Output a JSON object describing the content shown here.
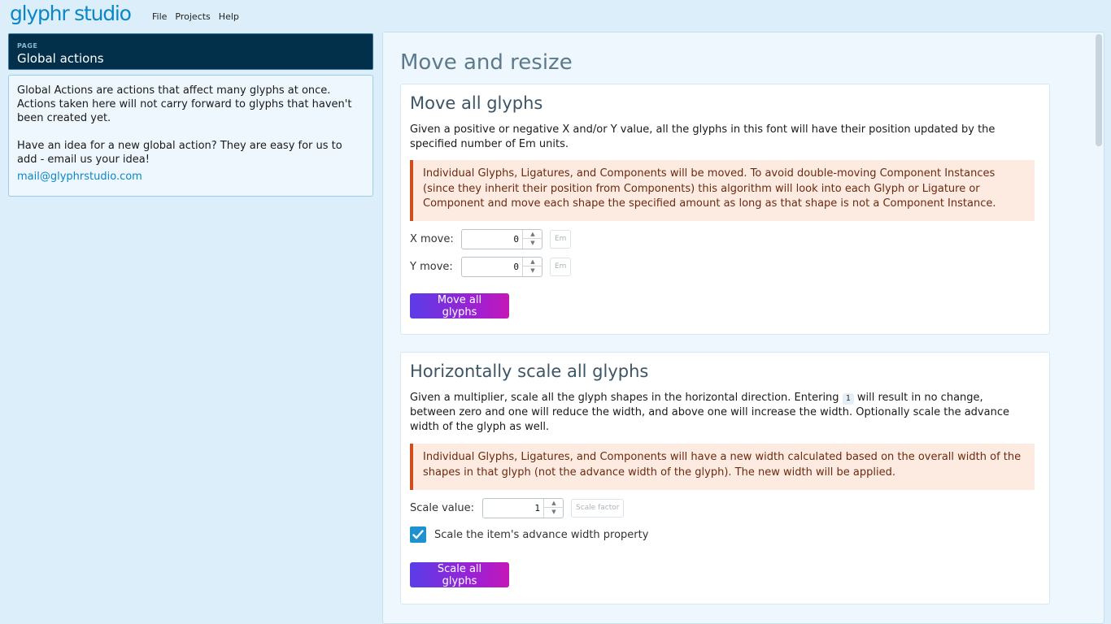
{
  "app": {
    "logo": "glyphr studio",
    "menu": [
      "File",
      "Projects",
      "Help"
    ]
  },
  "sidebar": {
    "kicker": "PAGE",
    "title": "Global actions",
    "paragraph1": "Global Actions are actions that affect many glyphs at once. Actions taken here will not carry forward to glyphs that haven't been created yet.",
    "paragraph2": "Have an idea for a new global action? They are easy for us to add - email us your idea!",
    "email": "mail@glyphrstudio.com"
  },
  "main": {
    "title": "Move and resize",
    "move_card": {
      "title": "Move all glyphs",
      "description": "Given a positive or negative X and/or Y value, all the glyphs in this font will have their position updated by the specified number of Em units.",
      "notice": "Individual Glyphs, Ligatures, and Components will be moved. To avoid double-moving Component Instances (since they inherit their position from Components) this algorithm will look into each Glyph or Ligature or Component and move each shape the specified amount as long as that shape is not a Component Instance.",
      "x_label": "X move:",
      "x_value": "0",
      "y_label": "Y move:",
      "y_value": "0",
      "unit": "Em",
      "button": "Move all glyphs"
    },
    "scale_card": {
      "title": "Horizontally scale all glyphs",
      "description_before": "Given a multiplier, scale all the glyph shapes in the horizontal direction. Entering",
      "description_code": "1",
      "description_after": "will result in no change, between zero and one will reduce the width, and above one will increase the width. Optionally scale the advance width of the glyph as well.",
      "notice": "Individual Glyphs, Ligatures, and Components will have a new width calculated based on the overall width of the shapes in that glyph (not the advance width of the glyph). The new width will be applied.",
      "scale_label": "Scale value:",
      "scale_value": "1",
      "unit": "Scale factor",
      "checkbox_label": "Scale the item's advance width property",
      "checkbox_checked": true,
      "button": "Scale all glyphs"
    }
  },
  "colors": {
    "background": "#dbeefa",
    "accent": "#0a87c9",
    "header": "#02304a",
    "notice_border": "#d24c1c",
    "notice_bg": "#fdebe2"
  }
}
